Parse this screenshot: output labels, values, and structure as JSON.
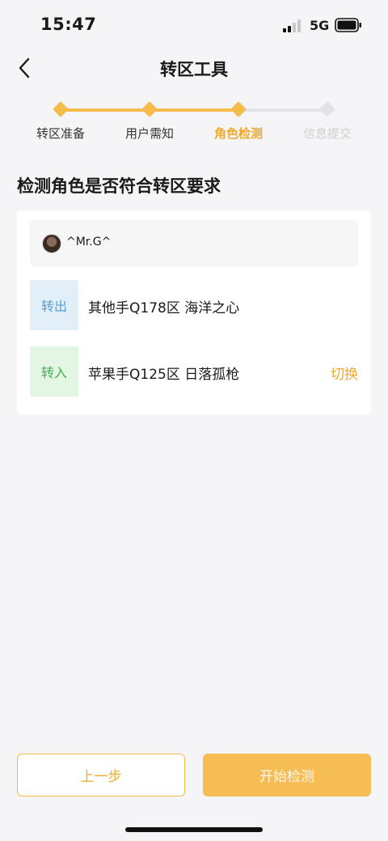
{
  "status_bar": {
    "time": "15:47",
    "network": "5G"
  },
  "nav": {
    "title": "转区工具",
    "back_icon": "chevron-left-icon"
  },
  "stepper": {
    "steps": [
      {
        "label": "转区准备",
        "state": "done"
      },
      {
        "label": "用户需知",
        "state": "done"
      },
      {
        "label": "角色检测",
        "state": "active"
      },
      {
        "label": "信息提交",
        "state": "todo"
      }
    ],
    "accent_color": "#f5bb4b",
    "inactive_color": "#e3e3e6"
  },
  "section": {
    "title": "检测角色是否符合转区要求"
  },
  "character": {
    "username": "^Mr.G^"
  },
  "transfer": {
    "out": {
      "tag": "转出",
      "server": "其他手Q178区 海洋之心"
    },
    "in": {
      "tag": "转入",
      "server": "苹果手Q125区 日落孤枪",
      "switch_label": "切换"
    }
  },
  "buttons": {
    "prev_label": "上一步",
    "start_label": "开始检测"
  }
}
